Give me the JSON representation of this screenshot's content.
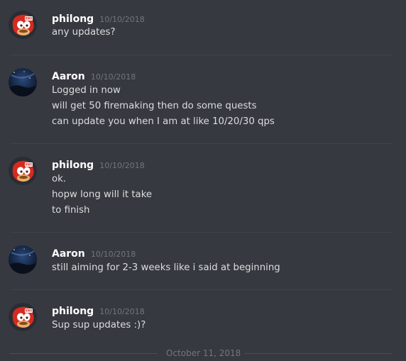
{
  "messages": [
    {
      "author": "philong",
      "timestamp": "10/10/2018",
      "lines": [
        "any updates?"
      ]
    },
    {
      "author": "Aaron",
      "timestamp": "10/10/2018",
      "lines": [
        "Logged in now",
        "will get 50 firemaking then do some quests",
        "can update you when I am at like 10/20/30 qps"
      ]
    },
    {
      "author": "philong",
      "timestamp": "10/10/2018",
      "lines": [
        "ok.",
        "hopw long will it take",
        "to finish"
      ]
    },
    {
      "author": "Aaron",
      "timestamp": "10/10/2018",
      "lines": [
        "still aiming for 2-3 weeks like i said at beginning"
      ]
    },
    {
      "author": "philong",
      "timestamp": "10/10/2018",
      "lines": [
        "Sup sup updates :)?"
      ]
    }
  ],
  "date_divider": "October 11, 2018",
  "avatar_badge": "KNO",
  "colors": {
    "background": "#36393f",
    "username": "#ffffff",
    "timestamp": "#72767d",
    "message_text": "#dcddde",
    "knuckles_red": "#d42b20",
    "aaron_night": "#0e1a33"
  }
}
